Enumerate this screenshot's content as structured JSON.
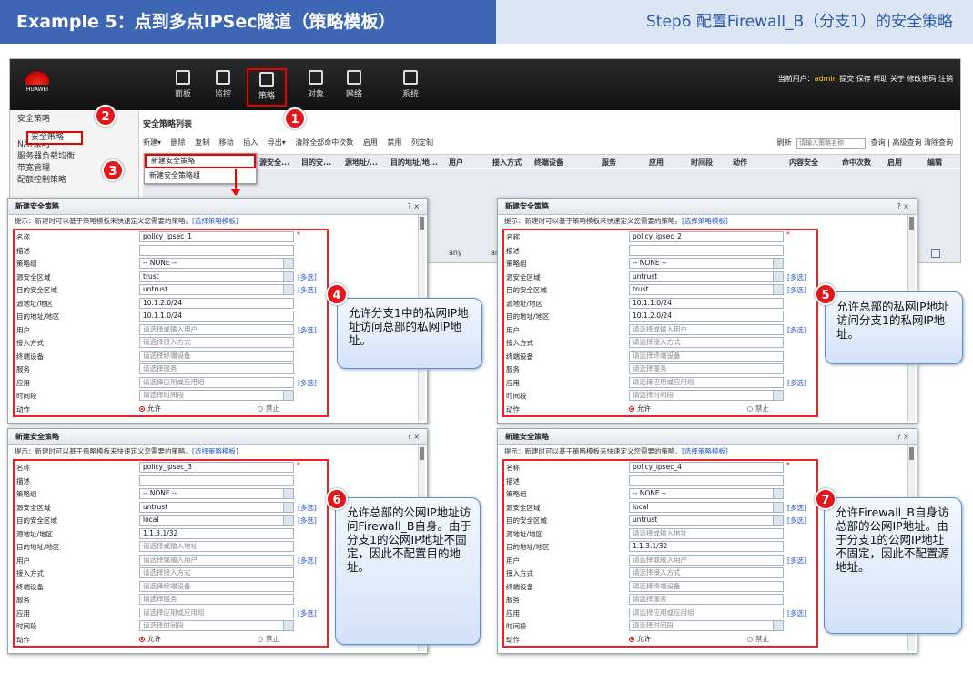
{
  "header": {
    "left_title": "Example 5：点到多点IPSec隧道（策略模板）",
    "right_title": "Step6 配置Firewall_B（分支1）的安全策略"
  },
  "app": {
    "logo_text": "HUAWEI",
    "nav": [
      "面板",
      "监控",
      "策略",
      "对象",
      "网络",
      "系统"
    ],
    "user_label": "当前用户：",
    "user_name": "admin",
    "user_links": "提交  保存  帮助  关于  修改密码  注销",
    "tree": [
      "安全策略",
      "安全策略",
      "NAT策略",
      "服务器负载均衡",
      "带宽管理",
      "配额控制策略"
    ],
    "panel_title": "安全策略列表",
    "toolbar": [
      "新建▾",
      "删除",
      "复制",
      "移动",
      "插入",
      "导出▾",
      "清除全部命中次数",
      "启用",
      "禁用",
      "列定制"
    ],
    "refresh": "刷新",
    "search_placeholder": "请输入策略名称",
    "query": "查询",
    "advanced_query": "高级查询",
    "clear_query": "清除查询",
    "columns": [
      "源安全...",
      "目的安...",
      "源地址/...",
      "目的地址/地...",
      "用户",
      "接入方式",
      "终端设备",
      "服务",
      "应用",
      "时间段",
      "动作",
      "内容安全",
      "命中次数",
      "启用",
      "编辑"
    ],
    "dropdown": [
      "新建安全策略",
      "新建安全策略组"
    ],
    "row_any": "any",
    "row_trunc": "an"
  },
  "badges": [
    "1",
    "2",
    "3",
    "4",
    "5",
    "6",
    "7"
  ],
  "dialog_common": {
    "title": "新建安全策略",
    "controls": "?  ×",
    "hint": "提示：新建时可以基于策略模板来快速定义您需要的策略。",
    "hint_link": "[选择策略模板]",
    "labels": [
      "名称",
      "描述",
      "策略组",
      "源安全区域",
      "目的安全区域",
      "源地址/地区",
      "目的地址/地区",
      "用户",
      "接入方式",
      "终端设备",
      "服务",
      "应用",
      "时间段",
      "动作"
    ],
    "multi": "[多选]",
    "permit": "允许",
    "deny": "禁止",
    "none": "-- NONE --",
    "ph_user": "请选择或输入用户",
    "ph_access": "请选择接入方式",
    "ph_device": "请选择终端设备",
    "ph_service": "请选择服务",
    "ph_app": "请选择应用或应用组",
    "ph_time": "请选择时间段",
    "ph_addr": "请选择或输入地址"
  },
  "dialogs": [
    {
      "name": "policy_ipsec_1",
      "src_zone": "trust",
      "dst_zone": "untrust",
      "src_addr": "10.1.2.0/24",
      "dst_addr": "10.1.1.0/24"
    },
    {
      "name": "policy_ipsec_2",
      "src_zone": "untrust",
      "dst_zone": "trust",
      "src_addr": "10.1.1.0/24",
      "dst_addr": "10.1.2.0/24"
    },
    {
      "name": "policy_ipsec_3",
      "src_zone": "untrust",
      "dst_zone": "local",
      "src_addr": "1.1.3.1/32",
      "dst_addr": ""
    },
    {
      "name": "policy_ipsec_4",
      "src_zone": "local",
      "dst_zone": "untrust",
      "src_addr": "",
      "dst_addr": "1.1.3.1/32"
    }
  ],
  "callouts": [
    "允许分支1中的私网IP地址访问总部的私网IP地址。",
    "允许总部的私网IP地址访问分支1的私网IP地址。",
    "允许总部的公网IP地址访问Firewall_B自身。由于分支1的公网IP地址不固定，因此不配置目的地址。",
    "允许Firewall_B自身访总部的公网IP地址。由于分支1的公网IP地址不固定，因此不配置源地址。"
  ],
  "colors": {
    "header_blue": "#3d66b4",
    "header_light": "#dce5f3",
    "highlight_red": "#e3161b",
    "callout_border": "#5b8fd6"
  }
}
